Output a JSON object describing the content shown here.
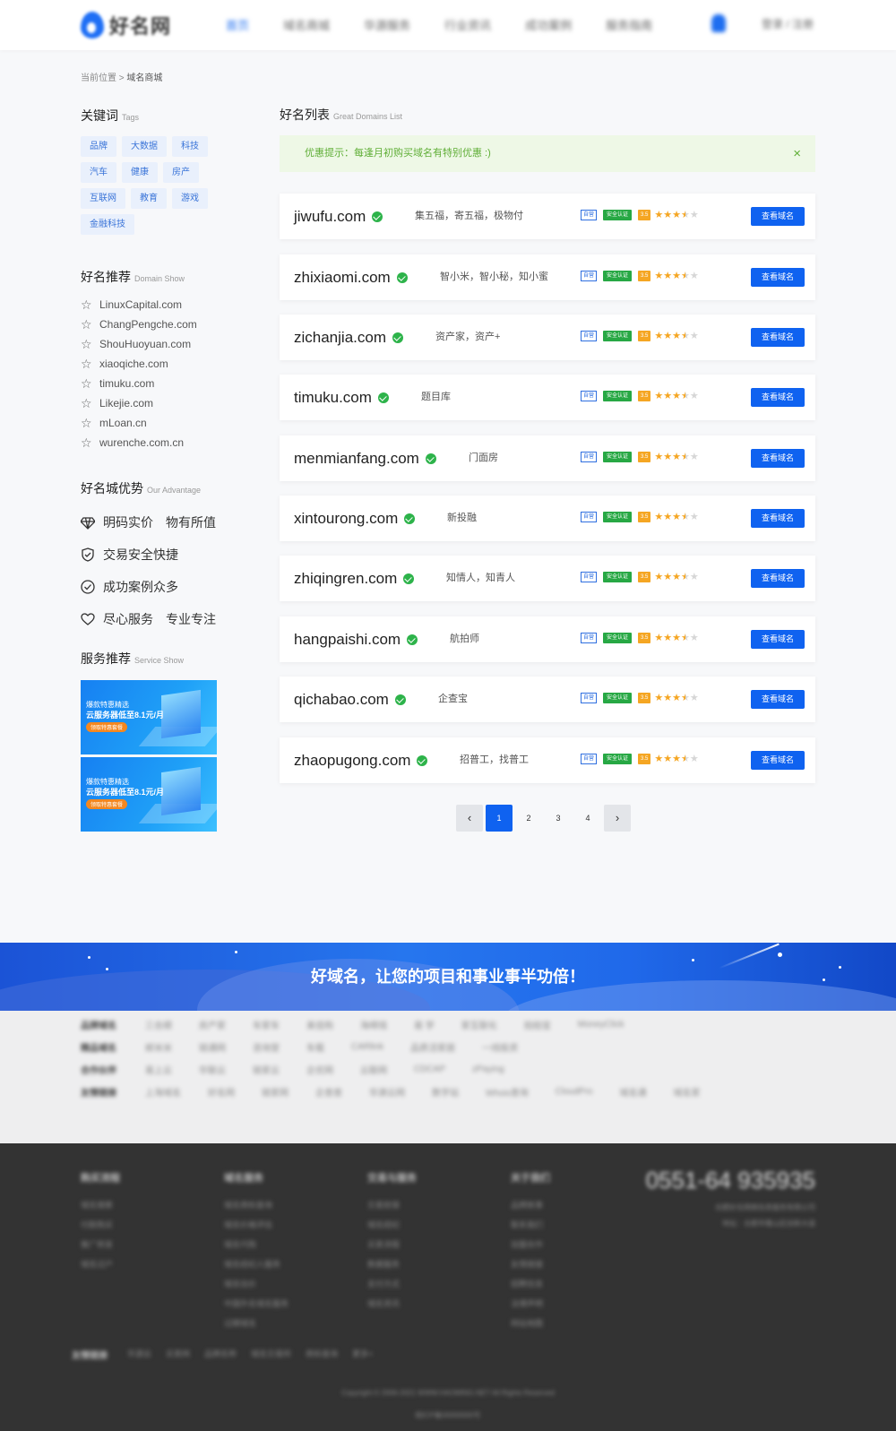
{
  "header": {
    "logo": "好名网",
    "nav": [
      "首页",
      "域名商城",
      "华源服务",
      "行业资讯",
      "成功案例",
      "服务指南"
    ],
    "user": "登录 / 注册"
  },
  "breadcrumb": {
    "prefix": "当前位置",
    "sep": ">",
    "current": "域名商城"
  },
  "keywords": {
    "title": "关键词",
    "subtitle": "Tags",
    "tags": [
      "品牌",
      "大数据",
      "科技",
      "汽车",
      "健康",
      "房产",
      "互联网",
      "教育",
      "游戏",
      "金融科技"
    ]
  },
  "domain_show": {
    "title": "好名推荐",
    "subtitle": "Domain Show",
    "items": [
      "LinuxCapital.com",
      "ChangPengche.com",
      "ShouHuoyuan.com",
      "xiaoqiche.com",
      "timuku.com",
      "Likejie.com",
      "mLoan.cn",
      "wurenche.com.cn"
    ]
  },
  "advantage": {
    "title": "好名城优势",
    "subtitle": "Our Advantage",
    "items": [
      "明码实价　物有所值",
      "交易安全快捷",
      "成功案例众多",
      "尽心服务　专业专注"
    ]
  },
  "service": {
    "title": "服务推荐",
    "subtitle": "Service Show",
    "banners": [
      {
        "line1": "爆款特惠精选",
        "line2": "云服务器低至8.1元/月",
        "cta": "领取特惠套餐"
      },
      {
        "line1": "爆款特惠精选",
        "line2": "云服务器低至8.1元/月",
        "cta": "领取特惠套餐"
      }
    ]
  },
  "list": {
    "title": "好名列表",
    "subtitle": "Great Domains List",
    "notice": "优惠提示：每逢月初购买域名有特别优惠 :)",
    "close": "×",
    "badge_self": "自营",
    "badge_safe": "安全认证",
    "score": "3.5",
    "rating": 3.5,
    "button": "查看域名",
    "domains": [
      {
        "name": "jiwufu.com",
        "meaning": "集五福，寄五福，极物付"
      },
      {
        "name": "zhixiaomi.com",
        "meaning": "智小米，智小秘，知小蜜"
      },
      {
        "name": "zichanjia.com",
        "meaning": "资产家，资产+"
      },
      {
        "name": "timuku.com",
        "meaning": "题目库"
      },
      {
        "name": "menmianfang.com",
        "meaning": "门面房"
      },
      {
        "name": "xintourong.com",
        "meaning": "新投融"
      },
      {
        "name": "zhiqingren.com",
        "meaning": "知情人，知青人"
      },
      {
        "name": "hangpaishi.com",
        "meaning": "航拍师"
      },
      {
        "name": "qichabao.com",
        "meaning": "企查宝"
      },
      {
        "name": "zhaopugong.com",
        "meaning": "招普工，找普工"
      }
    ]
  },
  "pagination": {
    "prev": "‹",
    "next": "›",
    "pages": [
      "1",
      "2",
      "3",
      "4"
    ],
    "current": "1"
  },
  "slogan": "好域名，让您的项目和事业事半功倍！",
  "footer": {
    "link_rows": [
      {
        "label": "品牌域名",
        "items": [
          "三合顺",
          "房产家",
          "车家车",
          "美佳购",
          "海绵钱",
          "易 学",
          "家互联化",
          "拍拍宝",
          "MoneyClick"
        ]
      },
      {
        "label": "精品域名",
        "items": [
          "邮米米",
          "链通网",
          "咨询堂",
          "车载",
          "CARlink",
          "品质活家居",
          "一线投资"
        ]
      },
      {
        "label": "合作伙伴",
        "items": [
          "易上云",
          "华联云",
          "链家云",
          "企优网",
          "云联网",
          "CDCAP",
          "zPaying"
        ]
      },
      {
        "label": "友情链接",
        "items": [
          "上海域名",
          "好名网",
          "链家网",
          "企查查",
          "华源云网",
          "数字站",
          "Whois查询",
          "CloudPro",
          "域名通",
          "域名家"
        ]
      }
    ],
    "cols": [
      {
        "title": "购买流程",
        "items": [
          "域名搜索",
          "付款购买",
          "推广转发",
          "域名过户"
        ]
      },
      {
        "title": "域名服务",
        "items": [
          "域名商标查询",
          "域名价格评估",
          "域名代购",
          "域名经纪人服务",
          "域名估价",
          "中国外名域名服务",
          "过期域名"
        ]
      },
      {
        "title": "交易与服务",
        "items": [
          "交易担保",
          "域名经纪",
          "买卖流程",
          "数据服务",
          "支付方式",
          "域名资讯"
        ]
      },
      {
        "title": "关于我们",
        "items": [
          "品牌故事",
          "联系我们",
          "加盟合作",
          "友情链接",
          "招聘信息",
          "法律声明",
          "网站地图"
        ]
      }
    ],
    "phone": "0551-64 935935",
    "phone_note1": "合肥好名网络信息服务有限公司",
    "phone_note2": "地址：合肥市蜀山区创新大道",
    "bottom_label": "友情链接",
    "bottom_links": [
      "华源云",
      "买卖网",
      "品牌名称",
      "域名交易所",
      "商标查询",
      "更多+"
    ],
    "copyright": "Copyright © 2006-2021 WWW.HAOMING.NET All Rights Reserved",
    "icp": "皖ICP备00000000号"
  }
}
